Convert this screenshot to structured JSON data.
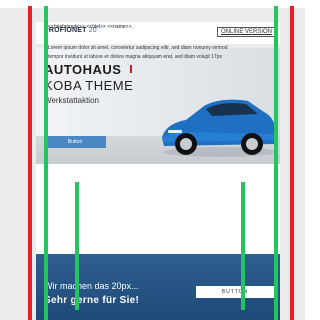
{
  "header": {
    "logo_text": "PROFIONET",
    "logo_suffix": "20",
    "online_version_label": "ONLINE VERSION"
  },
  "hero": {
    "title": "AUTOHAUS",
    "subtitle": "KOBA THEME",
    "text": "Werkstattaktion",
    "button_label": "Button"
  },
  "body": {
    "greeting": "<<briefanrede>> <<titel>> <<name>>,",
    "paragraph": "Lorem ipsum dolor sit amet, consetetur sadipscing elitr, sed diam nonumy eirmod tempor invidunt ut labore et dolore magna aliquyam erat, sed diam volupt 17px"
  },
  "footer": {
    "line1": "Wir machen das 20px...",
    "line2": "Sehr gerne für Sie!",
    "button_label": "BUTTON"
  },
  "colors": {
    "accent_blue": "#4a88c5",
    "accent_red": "#d71920",
    "footer_blue": "#1e4a78",
    "guide_red": "#ee1c24",
    "guide_green": "#22c55e"
  }
}
